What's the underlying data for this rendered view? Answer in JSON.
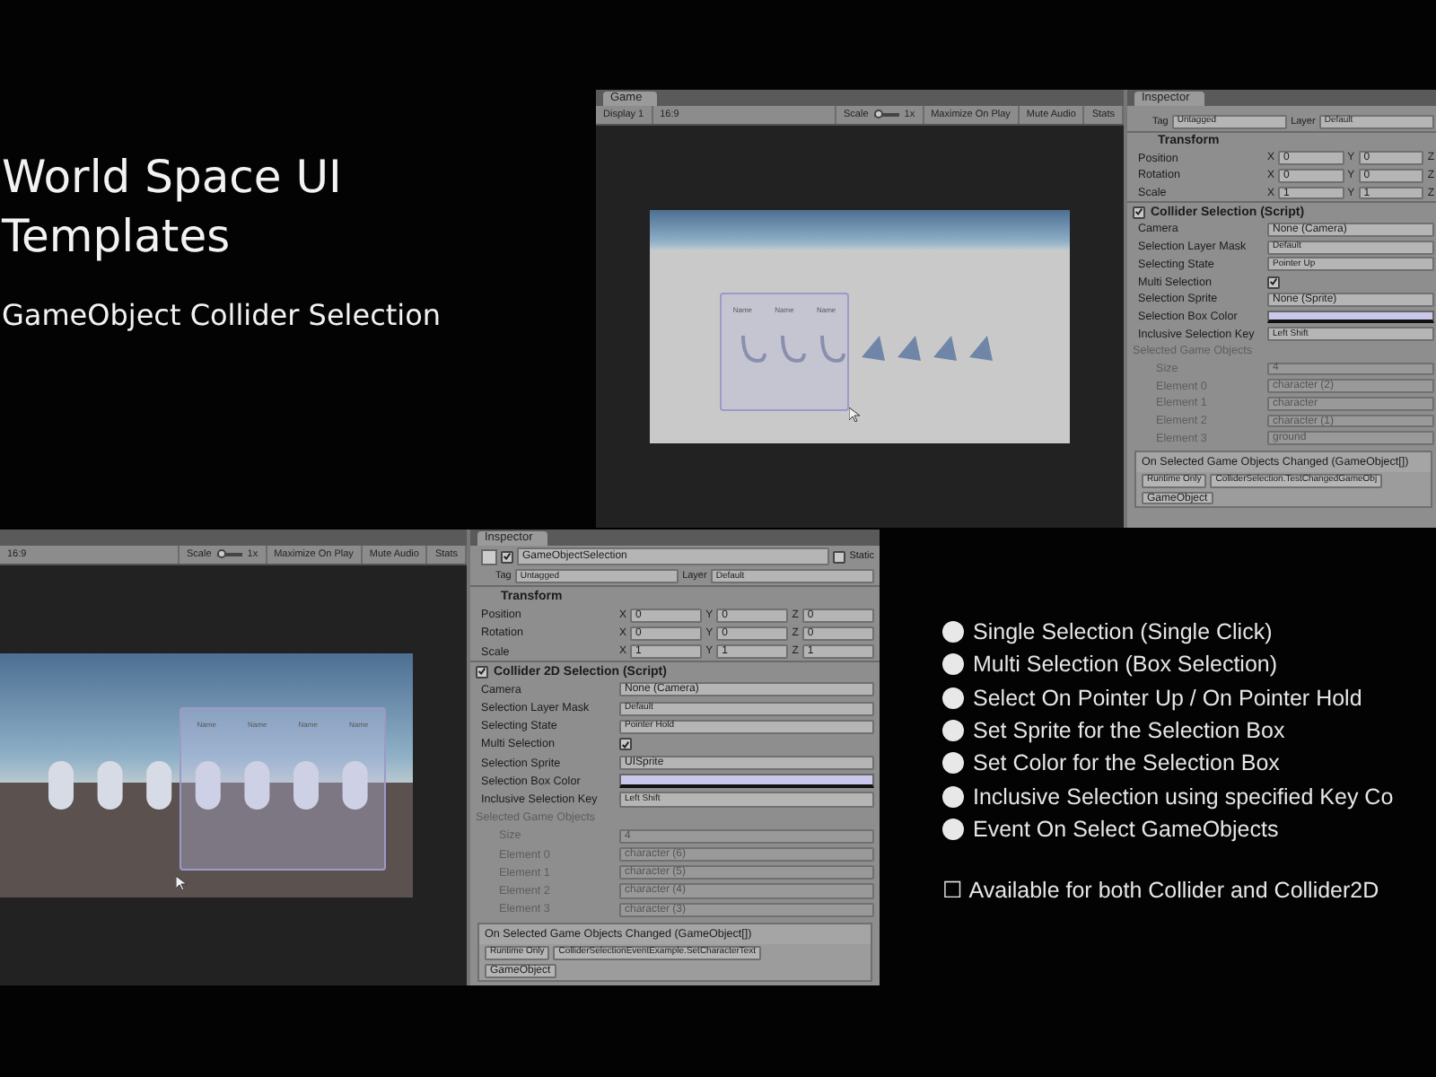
{
  "title": {
    "lines": [
      "World Space UI",
      "Templates"
    ],
    "subtitle": "GameObject Collider Selection"
  },
  "top_screenshot": {
    "game": {
      "tab": "Game",
      "display": "Display 1",
      "aspect": "16:9",
      "scale_label": "Scale",
      "scale_slider": {
        "level": 0
      },
      "scale_value": "1x",
      "toggles": [
        "Maximize On Play",
        "Mute Audio",
        "Stats"
      ],
      "name_labels": [
        "Name",
        "Name",
        "Name"
      ]
    },
    "inspector": {
      "tab": "Inspector",
      "tag_label": "Tag",
      "tag": "Untagged",
      "layer_label": "Layer",
      "layer": "Default",
      "transform": {
        "title": "Transform",
        "rows": [
          {
            "label": "Position",
            "axes": [
              "X",
              "Y",
              "Z"
            ],
            "values": [
              "0",
              "0"
            ]
          },
          {
            "label": "Rotation",
            "axes": [
              "X",
              "Y",
              "Z"
            ],
            "values": [
              "0",
              "0"
            ]
          },
          {
            "label": "Scale",
            "axes": [
              "X",
              "Y",
              "Z"
            ],
            "values": [
              "1",
              "1"
            ]
          }
        ]
      },
      "component": {
        "title": "Collider Selection (Script)",
        "enabled": true,
        "properties": [
          {
            "label": "Camera",
            "kind": "object",
            "value": "None (Camera)"
          },
          {
            "label": "Selection Layer Mask",
            "kind": "dropdown",
            "value": "Default"
          },
          {
            "label": "Selecting State",
            "kind": "dropdown",
            "value": "Pointer Up"
          },
          {
            "label": "Multi Selection",
            "kind": "toggle",
            "checked": true
          },
          {
            "label": "Selection Sprite",
            "kind": "object",
            "value": "None (Sprite)"
          },
          {
            "label": "Selection Box Color",
            "kind": "color",
            "color": "#c9c7ea"
          },
          {
            "label": "Inclusive Selection Key",
            "kind": "dropdown",
            "value": "Left Shift"
          }
        ]
      },
      "selected": {
        "title": "Selected Game Objects",
        "disabled": true,
        "size_label": "Size",
        "size": "4",
        "elements": [
          {
            "label": "Element 0",
            "value": "character (2)"
          },
          {
            "label": "Element 1",
            "value": "character"
          },
          {
            "label": "Element 2",
            "value": "character (1)"
          },
          {
            "label": "Element 3",
            "value": "ground"
          }
        ]
      },
      "event": {
        "title": "On Selected Game Objects Changed (GameObject[])",
        "mode": "Runtime Only",
        "function": "ColliderSelection.TestChangedGameObj",
        "target": "GameObject"
      }
    }
  },
  "bottom_screenshot": {
    "game": {
      "aspect": "16:9",
      "scale_label": "Scale",
      "scale_slider": {
        "level": 0
      },
      "scale_value": "1x",
      "toggles": [
        "Maximize On Play",
        "Mute Audio",
        "Stats"
      ],
      "name_labels": [
        "Name",
        "Name",
        "Name",
        "Name"
      ]
    },
    "inspector": {
      "tab": "Inspector",
      "object": {
        "name": "GameObjectSelection",
        "active": true,
        "static_label": "Static",
        "static": false
      },
      "tag_label": "Tag",
      "tag": "Untagged",
      "layer_label": "Layer",
      "layer": "Default",
      "transform": {
        "title": "Transform",
        "rows": [
          {
            "label": "Position",
            "axes": [
              "X",
              "Y",
              "Z"
            ],
            "values": [
              "0",
              "0",
              "0"
            ]
          },
          {
            "label": "Rotation",
            "axes": [
              "X",
              "Y",
              "Z"
            ],
            "values": [
              "0",
              "0",
              "0"
            ]
          },
          {
            "label": "Scale",
            "axes": [
              "X",
              "Y",
              "Z"
            ],
            "values": [
              "1",
              "1",
              "1"
            ]
          }
        ]
      },
      "component": {
        "title": "Collider 2D Selection (Script)",
        "enabled": true,
        "properties": [
          {
            "label": "Camera",
            "kind": "object",
            "value": "None (Camera)"
          },
          {
            "label": "Selection Layer Mask",
            "kind": "dropdown",
            "value": "Default"
          },
          {
            "label": "Selecting State",
            "kind": "dropdown",
            "value": "Pointer Hold"
          },
          {
            "label": "Multi Selection",
            "kind": "toggle",
            "checked": true
          },
          {
            "label": "Selection Sprite",
            "kind": "object",
            "value": "UISprite"
          },
          {
            "label": "Selection Box Color",
            "kind": "color",
            "color": "#c9c7ea"
          },
          {
            "label": "Inclusive Selection Key",
            "kind": "dropdown",
            "value": "Left Shift"
          }
        ]
      },
      "selected": {
        "title": "Selected Game Objects",
        "disabled": true,
        "size_label": "Size",
        "size": "4",
        "elements": [
          {
            "label": "Element 0",
            "value": "character (6)"
          },
          {
            "label": "Element 1",
            "value": "character (5)"
          },
          {
            "label": "Element 2",
            "value": "character (4)"
          },
          {
            "label": "Element 3",
            "value": "character (3)"
          }
        ]
      },
      "event": {
        "title": "On Selected Game Objects Changed (GameObject[])",
        "mode": "Runtime Only",
        "function": "ColliderSelectionEventExample.SetCharacterText",
        "target": "GameObject"
      }
    }
  },
  "features": [
    "Single Selection (Single Click)",
    "Multi Selection (Box Selection)",
    "Select On Pointer Up / On Pointer Hold",
    "Set Sprite for the Selection Box",
    "Set Color for the Selection Box",
    "Inclusive Selection using specified Key Co",
    "Event On Select GameObjects"
  ],
  "note": "☐ Available for both Collider and Collider2D"
}
